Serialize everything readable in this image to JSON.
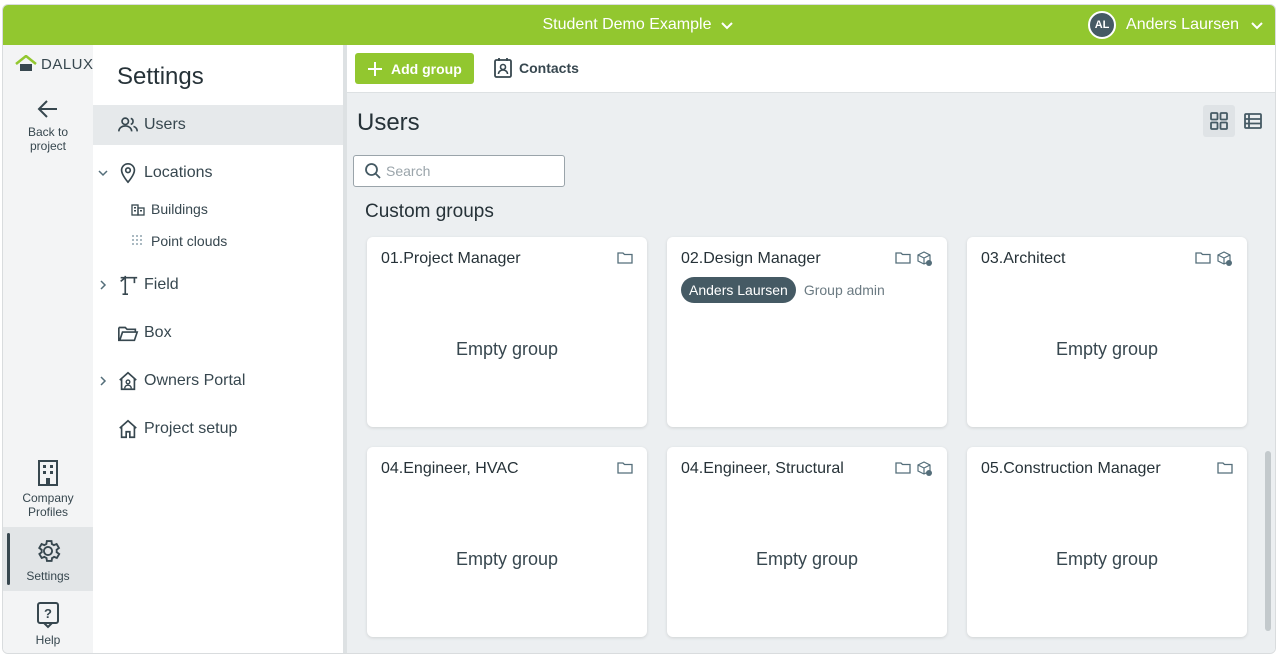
{
  "topbar": {
    "project_name": "Student Demo Example",
    "user_initials": "AL",
    "user_name": "Anders Laursen"
  },
  "rail": {
    "logo": "DALUX",
    "back_line1": "Back to",
    "back_line2": "project",
    "company_line1": "Company",
    "company_line2": "Profiles",
    "settings": "Settings",
    "help": "Help"
  },
  "settings_nav": {
    "title": "Settings",
    "users": "Users",
    "locations": "Locations",
    "buildings": "Buildings",
    "point_clouds": "Point clouds",
    "field": "Field",
    "box": "Box",
    "owners_portal": "Owners Portal",
    "project_setup": "Project setup"
  },
  "toolbar": {
    "add_group": "Add group",
    "contacts": "Contacts"
  },
  "main": {
    "title": "Users",
    "search_placeholder": "Search",
    "section": "Custom groups"
  },
  "groups": [
    {
      "name": "01.Project Manager",
      "empty_label": "Empty group"
    },
    {
      "name": "02.Design Manager",
      "member": "Anders Laursen",
      "member_role": "Group admin"
    },
    {
      "name": "03.Architect",
      "empty_label": "Empty group"
    },
    {
      "name": "04.Engineer, HVAC",
      "empty_label": "Empty group"
    },
    {
      "name": "04.Engineer, Structural",
      "empty_label": "Empty group"
    },
    {
      "name": "05.Construction Manager",
      "empty_label": "Empty group"
    }
  ],
  "colors": {
    "brand_green": "#92c72f",
    "dark_slate": "#455a64",
    "background": "#eceff1"
  }
}
